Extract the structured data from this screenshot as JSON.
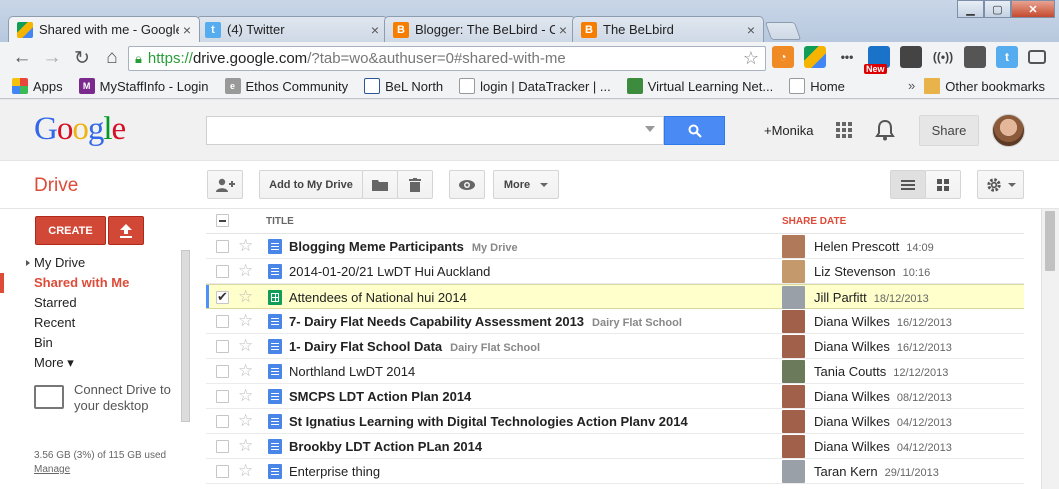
{
  "browser": {
    "tabs": [
      {
        "title": "Shared with me - Google D",
        "favicon": "google-drive",
        "active": true
      },
      {
        "title": "(4) Twitter",
        "favicon": "twitter"
      },
      {
        "title": "Blogger: The BeLbird - Cre",
        "favicon": "blogger"
      },
      {
        "title": "The BeLbird",
        "favicon": "blogger"
      }
    ],
    "url_scheme": "https://",
    "url_host": "drive.google.com",
    "url_rest": "/?tab=wo&authuser=0#shared-with-me",
    "bookmarks": [
      {
        "label": "Apps",
        "icon": "apps-grid-icon",
        "color": "#e8453c"
      },
      {
        "label": "MyStaffInfo - Login",
        "icon": "mystaffinfo-icon",
        "color": "#7a2a8c"
      },
      {
        "label": "Ethos Community",
        "icon": "ethos-icon",
        "color": "#777777"
      },
      {
        "label": "BeL North",
        "icon": "page-icon",
        "color": "#2b579a"
      },
      {
        "label": "login | DataTracker | ...",
        "icon": "page-icon",
        "color": "#888888"
      },
      {
        "label": "Virtual Learning Net...",
        "icon": "vln-icon",
        "color": "#3d8b3d"
      },
      {
        "label": "Home",
        "icon": "page-icon",
        "color": "#888888"
      }
    ],
    "overflow_chevron": "»",
    "other_bookmarks": "Other bookmarks",
    "new_badge": "New"
  },
  "google": {
    "logo": [
      "G",
      "o",
      "o",
      "g",
      "l",
      "e"
    ],
    "search_placeholder": "",
    "plus_name": "+Monika",
    "share_label": "Share"
  },
  "drive": {
    "title": "Drive",
    "add_to_my_drive": "Add to My Drive",
    "more_label": "More",
    "create_label": "CREATE",
    "nav": [
      {
        "label": "My Drive",
        "expandable": true
      },
      {
        "label": "Shared with Me",
        "active": true
      },
      {
        "label": "Starred"
      },
      {
        "label": "Recent"
      },
      {
        "label": "Bin"
      },
      {
        "label": "More ▾"
      }
    ],
    "connect_line1": "Connect Drive to",
    "connect_line2": "your desktop",
    "storage_text": "3.56 GB (3%) of 115 GB used",
    "manage_label": "Manage",
    "columns": {
      "title": "TITLE",
      "share_date": "SHARE DATE"
    },
    "files": [
      {
        "name": "Blogging Meme Participants",
        "location": "My Drive",
        "type": "doc",
        "bold": true,
        "sharer": "Helen Prescott",
        "date": "14:09",
        "avatar_color": "#b07a5a",
        "selected": false
      },
      {
        "name": "2014-01-20/21 LwDT Hui Auckland",
        "location": "",
        "type": "doc",
        "bold": false,
        "sharer": "Liz Stevenson",
        "date": "10:16",
        "avatar_color": "#c49a6c",
        "selected": false
      },
      {
        "name": "Attendees of National hui 2014",
        "location": "",
        "type": "sheet",
        "bold": false,
        "sharer": "Jill Parfitt",
        "date": "18/12/2013",
        "avatar_color": "#9aa0a8",
        "selected": true
      },
      {
        "name": "7- Dairy Flat Needs Capability Assessment 2013",
        "location": "Dairy Flat School",
        "type": "doc",
        "bold": true,
        "sharer": "Diana Wilkes",
        "date": "16/12/2013",
        "avatar_color": "#a0604a",
        "selected": false
      },
      {
        "name": "1- Dairy Flat School Data",
        "location": "Dairy Flat School",
        "type": "doc",
        "bold": true,
        "sharer": "Diana Wilkes",
        "date": "16/12/2013",
        "avatar_color": "#a0604a",
        "selected": false
      },
      {
        "name": "Northland LwDT 2014",
        "location": "",
        "type": "doc",
        "bold": false,
        "sharer": "Tania Coutts",
        "date": "12/12/2013",
        "avatar_color": "#6a7a5a",
        "selected": false
      },
      {
        "name": "SMCPS LDT Action Plan 2014",
        "location": "",
        "type": "doc",
        "bold": true,
        "sharer": "Diana Wilkes",
        "date": "08/12/2013",
        "avatar_color": "#a0604a",
        "selected": false
      },
      {
        "name": "St Ignatius Learning with Digital Technologies Action Planv 2014",
        "location": "",
        "type": "doc",
        "bold": true,
        "sharer": "Diana Wilkes",
        "date": "04/12/2013",
        "avatar_color": "#a0604a",
        "selected": false
      },
      {
        "name": "Brookby LDT Action PLan 2014",
        "location": "",
        "type": "doc",
        "bold": true,
        "sharer": "Diana Wilkes",
        "date": "04/12/2013",
        "avatar_color": "#a0604a",
        "selected": false
      },
      {
        "name": "Enterprise thing",
        "location": "",
        "type": "doc",
        "bold": false,
        "sharer": "Taran Kern",
        "date": "29/11/2013",
        "avatar_color": "#9aa0a8",
        "selected": false
      }
    ]
  },
  "colors": {
    "accent": "#dd4b39",
    "search_blue": "#4a8af4",
    "doc_blue": "#4986e7",
    "sheet_green": "#0f9d58",
    "selected_row": "#ffffcc"
  }
}
